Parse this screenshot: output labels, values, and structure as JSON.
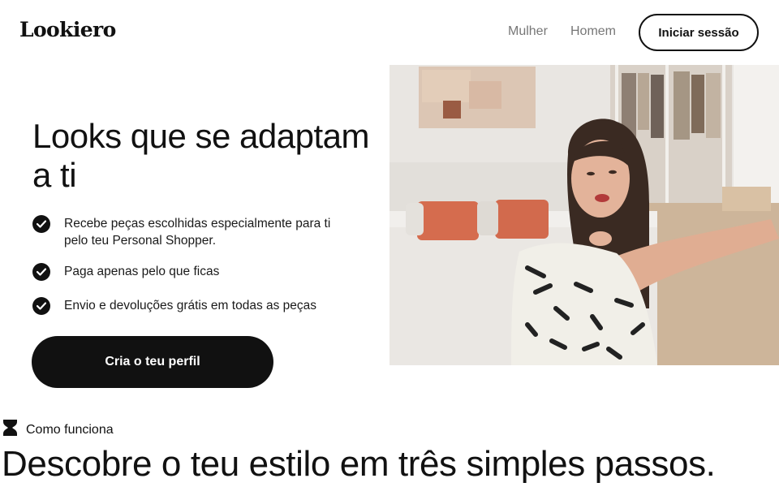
{
  "header": {
    "logo": "Lookiero",
    "nav": [
      {
        "label": "Mulher"
      },
      {
        "label": "Homem"
      }
    ],
    "login_label": "Iniciar sessão"
  },
  "hero": {
    "title": "Looks que se adaptam a ti",
    "features": [
      {
        "text": "Recebe peças escolhidas especialmente para ti pelo teu Personal Shopper.",
        "icon": "check-circle-icon"
      },
      {
        "text": "Paga apenas pelo que ficas",
        "icon": "check-circle-icon"
      },
      {
        "text": "Envio e devoluções grátis em todas as peças",
        "icon": "check-circle-icon"
      }
    ],
    "cta_label": "Cria o teu perfil",
    "media": {
      "icon": "hero-video-image"
    }
  },
  "how_it_works": {
    "tag_label": "Como funciona",
    "tag_icon": "hourglass-icon",
    "title": "Descobre o teu estilo em três simples passos."
  },
  "colors": {
    "primary": "#111111",
    "nav_text": "#777777",
    "background": "#ffffff"
  }
}
